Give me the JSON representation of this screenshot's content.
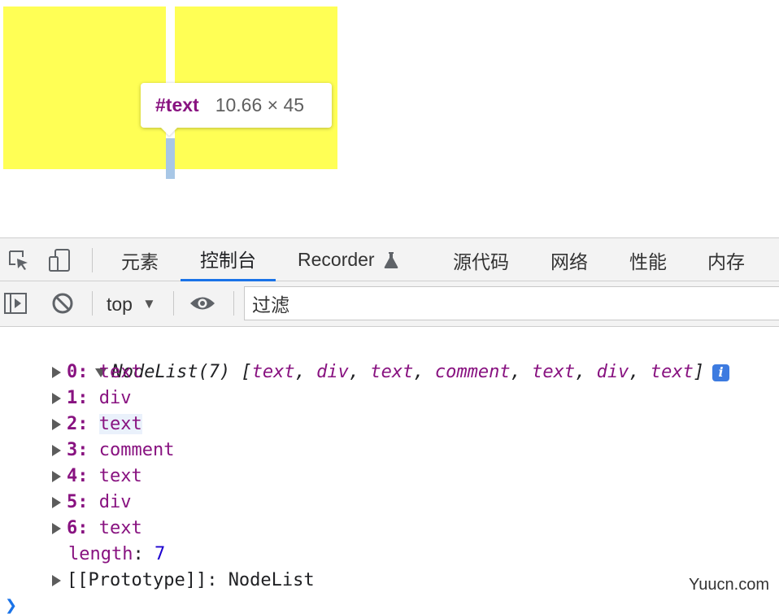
{
  "preview": {
    "tooltip": {
      "node_name": "#text",
      "size": "10.66 × 45"
    },
    "colors": {
      "box": "#ffff55",
      "highlight": "#a8c7e6"
    }
  },
  "devtools": {
    "toolbar_icons": [
      "inspect-element-icon",
      "device-toolbar-icon"
    ],
    "tabs": [
      {
        "label": "元素",
        "active": false
      },
      {
        "label": "控制台",
        "active": true
      },
      {
        "label": "Recorder",
        "active": false,
        "icon": "flask-icon"
      },
      {
        "label": "源代码",
        "active": false
      },
      {
        "label": "网络",
        "active": false
      },
      {
        "label": "性能",
        "active": false
      },
      {
        "label": "内存",
        "active": false
      }
    ],
    "console_toolbar": {
      "context": "top",
      "filter_placeholder": "过滤"
    },
    "accent": "#1a73e8"
  },
  "console": {
    "summary": {
      "label": "NodeList(7)",
      "items": [
        "text",
        "div",
        "text",
        "comment",
        "text",
        "div",
        "text"
      ]
    },
    "entries": [
      {
        "index": "0",
        "value": "text"
      },
      {
        "index": "1",
        "value": "div"
      },
      {
        "index": "2",
        "value": "text"
      },
      {
        "index": "3",
        "value": "comment"
      },
      {
        "index": "4",
        "value": "text"
      },
      {
        "index": "5",
        "value": "div"
      },
      {
        "index": "6",
        "value": "text"
      }
    ],
    "length_key": "length",
    "length_value": "7",
    "prototype_key": "[[Prototype]]",
    "prototype_value": "NodeList"
  },
  "watermark": "Yuucn.com"
}
